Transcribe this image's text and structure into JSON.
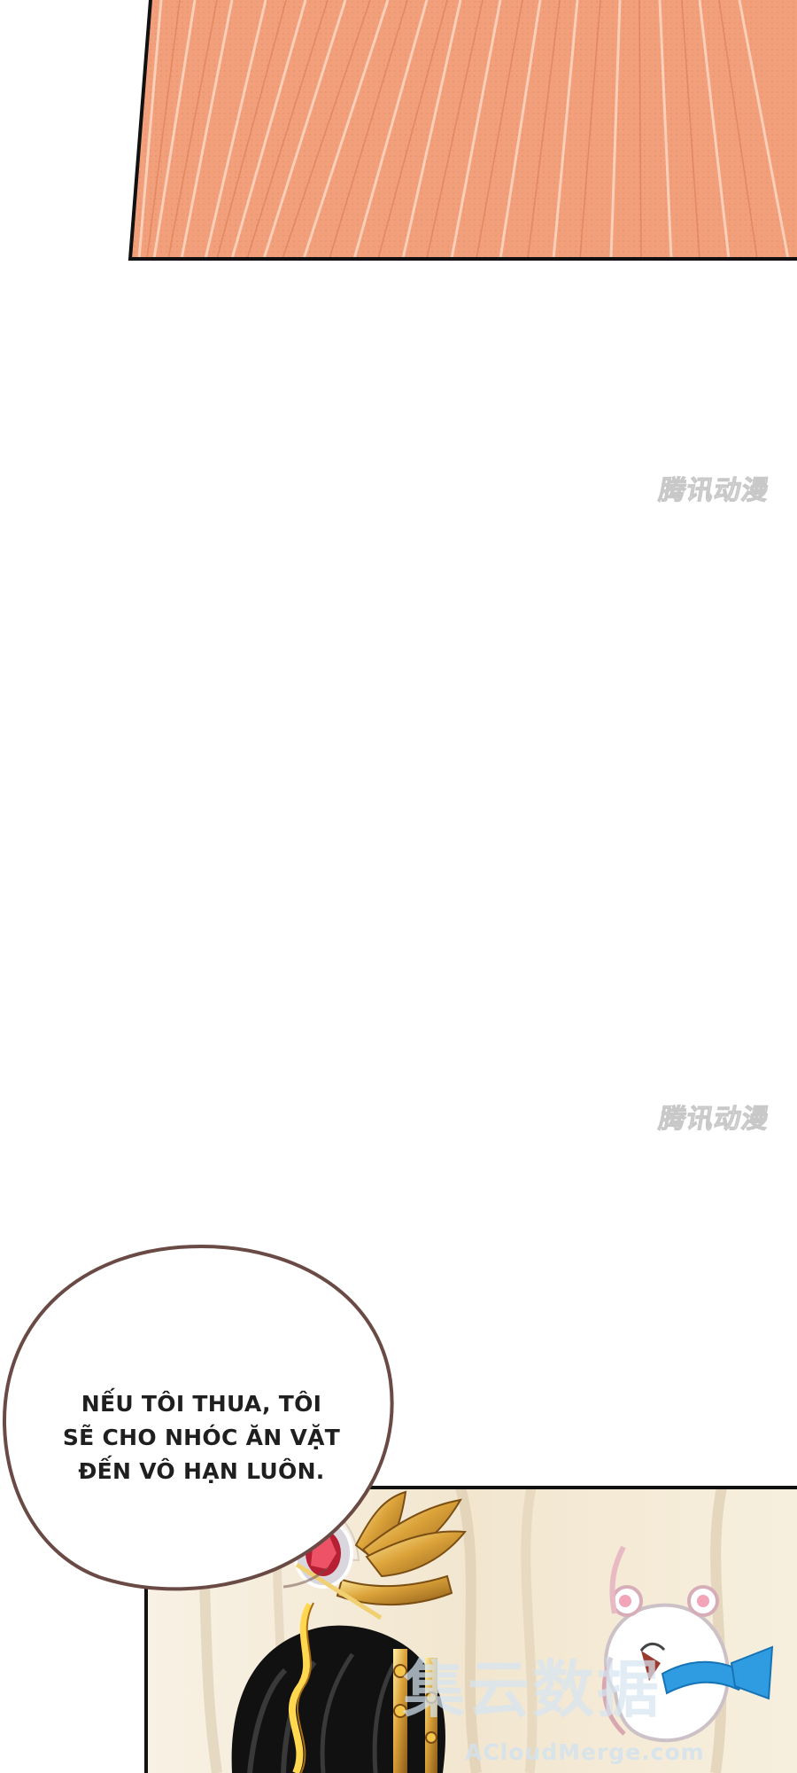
{
  "watermarks": [
    {
      "text": "腾讯动漫"
    },
    {
      "text": "腾讯动漫"
    }
  ],
  "speech_bubble": {
    "lines": [
      "NẾU TÔI THUA, TÔI",
      "SẼ CHO NHÓC ĂN VẶT",
      "ĐẾN VÔ HẠN LUÔN."
    ]
  },
  "bottom_watermark": {
    "text": "集云数据",
    "site": "ACloudMerge.com"
  },
  "colors": {
    "orange_panel": "#f1a07b",
    "panel_border": "#111111",
    "bubble_border": "#6a4a45",
    "cream_panel": "#f4ebd8",
    "gold": "#d8a12f",
    "black_hair": "#111111",
    "blue_ribbon": "#2f9be0"
  }
}
